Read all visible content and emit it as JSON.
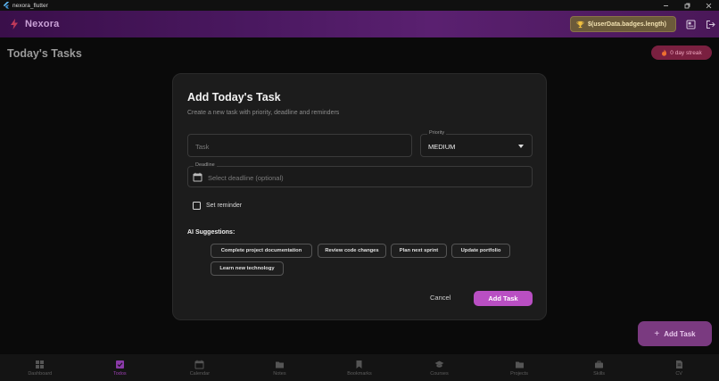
{
  "window": {
    "title": "nexora_flutter"
  },
  "appbar": {
    "brand": "Nexora",
    "badges_chip": "$(userData.badges.length)"
  },
  "page": {
    "title": "Today's Tasks",
    "streak": "0 day streak"
  },
  "dialog": {
    "title": "Add Today's Task",
    "subtitle": "Create a new task with priority, deadline and reminders",
    "task_placeholder": "Task",
    "priority_label": "Priority",
    "priority_value": "MEDIUM",
    "deadline_label": "Deadline",
    "deadline_placeholder": "Select deadline (optional)",
    "reminder_label": "Set reminder",
    "reminder_checked": false,
    "ai_label": "AI Suggestions:",
    "suggestions": [
      "Complete project documentation",
      "Review code changes",
      "Plan next sprint",
      "Update portfolio",
      "Learn new technology"
    ],
    "cancel": "Cancel",
    "add": "Add Task"
  },
  "fab": {
    "label": "Add Task"
  },
  "nav": {
    "items": [
      {
        "label": "Dashboard",
        "icon": "dashboard-icon"
      },
      {
        "label": "Todos",
        "icon": "checkbox-icon"
      },
      {
        "label": "Calendar",
        "icon": "calendar-icon"
      },
      {
        "label": "Notes",
        "icon": "folder-icon"
      },
      {
        "label": "Bookmarks",
        "icon": "bookmark-icon"
      },
      {
        "label": "Courses",
        "icon": "graduation-cap-icon"
      },
      {
        "label": "Projects",
        "icon": "folder-icon"
      },
      {
        "label": "Skills",
        "icon": "briefcase-icon"
      },
      {
        "label": "CV",
        "icon": "document-icon"
      }
    ],
    "active": "Todos"
  },
  "colors": {
    "accent": "#b94fc3",
    "fab": "#7a3a80",
    "streak": "#7a2040"
  }
}
